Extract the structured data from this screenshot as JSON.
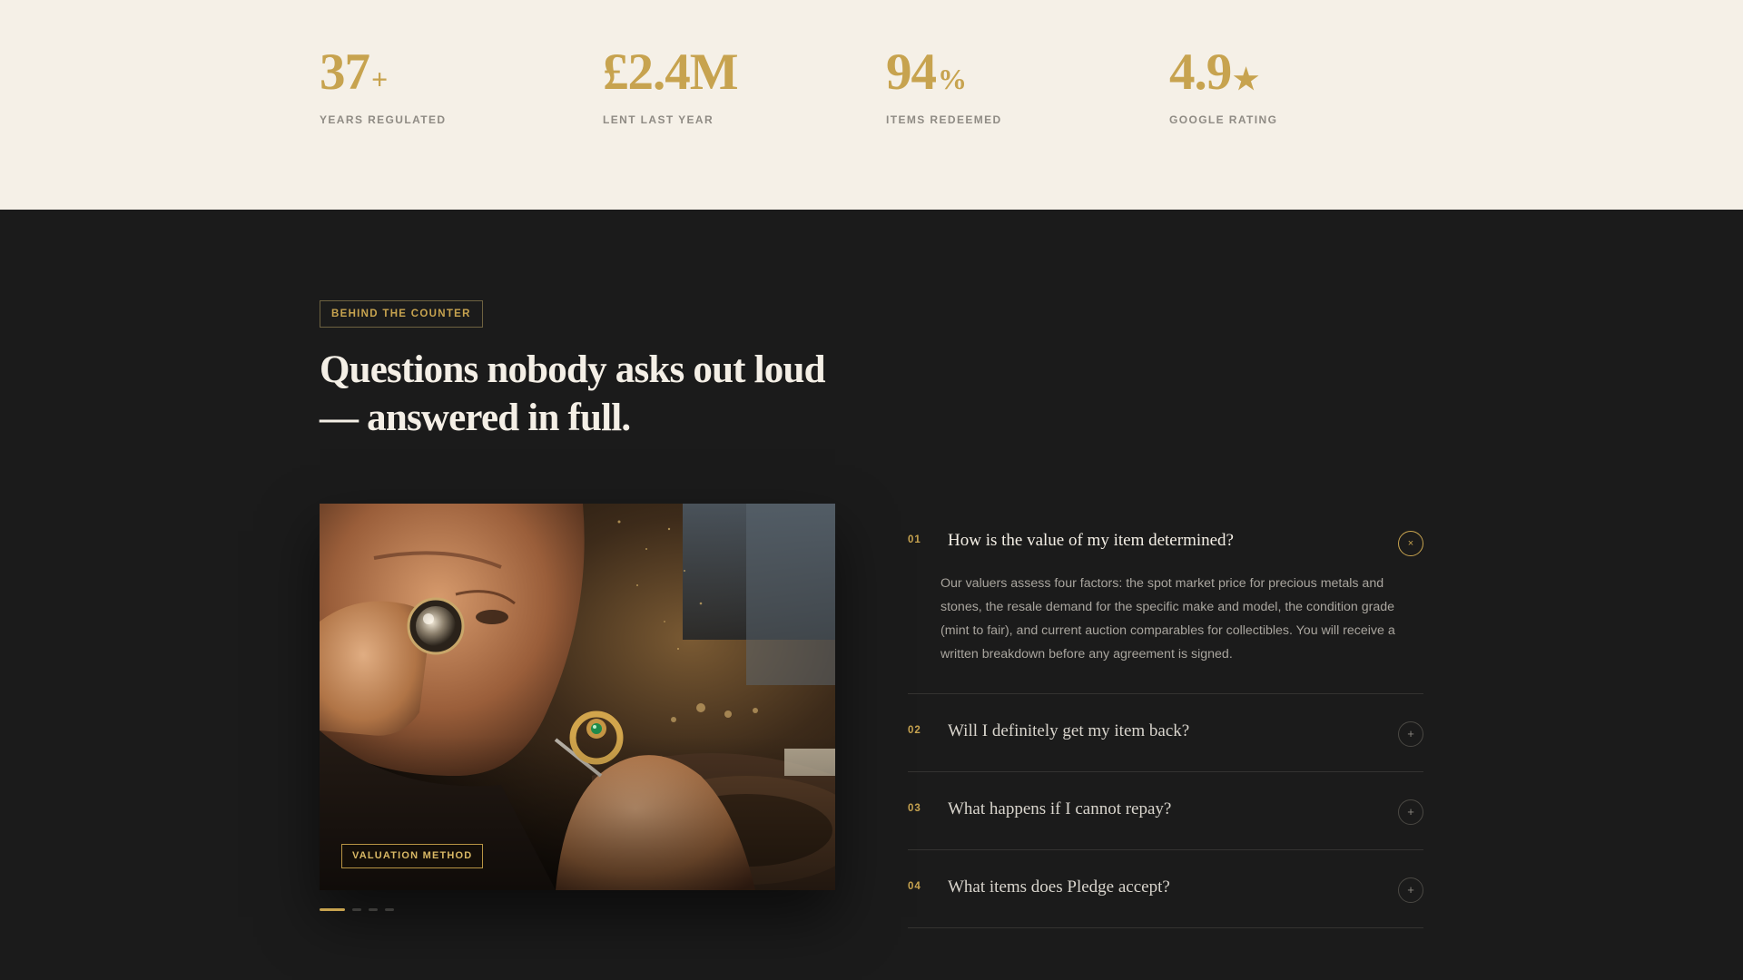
{
  "stats": [
    {
      "value": "37",
      "suffix": "+",
      "label": "YEARS REGULATED"
    },
    {
      "value": "£2.4M",
      "suffix": "",
      "label": "LENT LAST YEAR"
    },
    {
      "value": "94",
      "suffix": "%",
      "label": "ITEMS REDEEMED"
    },
    {
      "value": "4.9",
      "suffix": "★",
      "label": "GOOGLE RATING"
    }
  ],
  "section": {
    "eyebrow": "BEHIND THE COUNTER",
    "headline_line1": "Questions nobody asks out loud",
    "headline_line2": "— answered in full."
  },
  "photo": {
    "tag": "VALUATION METHOD",
    "slides_total": 4,
    "active_slide": 1
  },
  "faq": [
    {
      "num": "01",
      "question": "How is the value of my item determined?",
      "toggle": "×",
      "open": true,
      "answer": "Our valuers assess four factors: the spot market price for precious metals and stones, the resale demand for the specific make and model, the condition grade (mint to fair), and current auction comparables for collectibles. You will receive a written breakdown before any agreement is signed."
    },
    {
      "num": "02",
      "question": "Will I definitely get my item back?",
      "toggle": "+",
      "open": false
    },
    {
      "num": "03",
      "question": "What happens if I cannot repay?",
      "toggle": "+",
      "open": false
    },
    {
      "num": "04",
      "question": "What items does Pledge accept?",
      "toggle": "+",
      "open": false
    }
  ],
  "colors": {
    "gold": "#c7a34f",
    "cream": "#f5f0e7",
    "dark": "#1b1b1b"
  }
}
